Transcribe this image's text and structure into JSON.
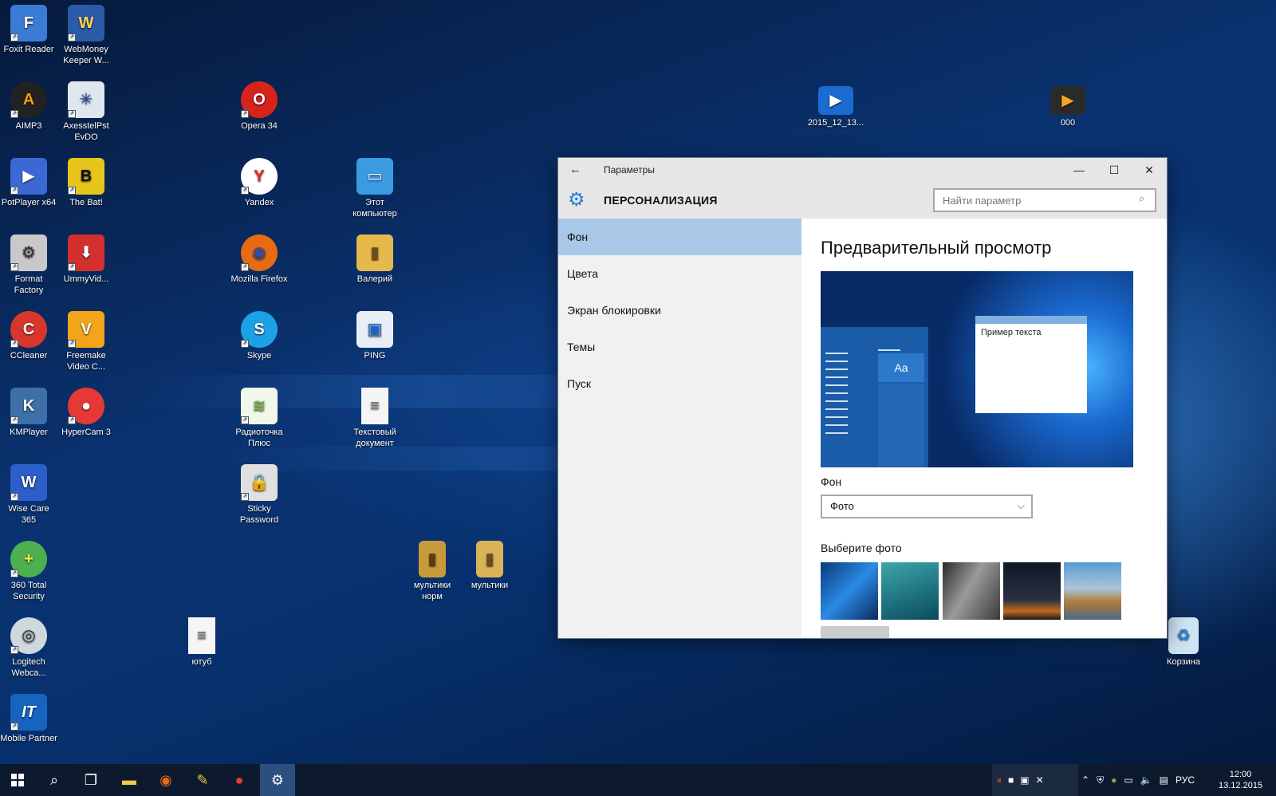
{
  "desktop": {
    "icons": [
      {
        "label": "Foxit Reader",
        "bg": "#3a7bd5",
        "glyph": "F"
      },
      {
        "label": "WebMoney Keeper W...",
        "bg": "#2b5aa8",
        "glyph": "W"
      },
      {
        "label": "AIMP3",
        "bg": "#f39c12",
        "glyph": "A"
      },
      {
        "label": "AxesstelPst EvDO",
        "bg": "#dfe6ee",
        "glyph": "✳"
      },
      {
        "label": "Opera 34",
        "bg": "#d6241c",
        "glyph": "O"
      },
      {
        "label": "2015_12_13...",
        "bg": "#1b6bd1",
        "glyph": "▶"
      },
      {
        "label": "000",
        "bg": "#2a2a2a",
        "glyph": "▶"
      },
      {
        "label": "PotPlayer x64",
        "bg": "#3c68d6",
        "glyph": "▶"
      },
      {
        "label": "The Bat!",
        "bg": "#e8c51d",
        "glyph": "B"
      },
      {
        "label": "Yandex",
        "bg": "#ffffff",
        "glyph": "Y"
      },
      {
        "label": "Этот компьютер",
        "bg": "#3a9be3",
        "glyph": "▭"
      },
      {
        "label": "Format Factory",
        "bg": "#c9c9c9",
        "glyph": "⚙"
      },
      {
        "label": "UmmyVid...",
        "bg": "#d32f2f",
        "glyph": "⬇"
      },
      {
        "label": "Mozilla Firefox",
        "bg": "#e66b12",
        "glyph": "◉"
      },
      {
        "label": "Валерий",
        "bg": "#e6b94d",
        "glyph": "▮"
      },
      {
        "label": "CCleaner",
        "bg": "#d9362b",
        "glyph": "C"
      },
      {
        "label": "Freemake Video C...",
        "bg": "#f2a51a",
        "glyph": "V"
      },
      {
        "label": "Skype",
        "bg": "#1da1e6",
        "glyph": "S"
      },
      {
        "label": "PING",
        "bg": "#1e64c8",
        "glyph": "▣"
      },
      {
        "label": "KMPlayer",
        "bg": "#3f6fa8",
        "glyph": "K"
      },
      {
        "label": "HyperCam 3",
        "bg": "#e53935",
        "glyph": "●"
      },
      {
        "label": "Радиоточка Плюс",
        "bg": "#7cb342",
        "glyph": "≋"
      },
      {
        "label": "Текстовый документ",
        "bg": "#f5f5f5",
        "glyph": "≡"
      },
      {
        "label": "Wise Care 365",
        "bg": "#2c5fc9",
        "glyph": "W"
      },
      {
        "label": "Sticky Password",
        "bg": "#e0e0e0",
        "glyph": "🔒"
      },
      {
        "label": "360 Total Security",
        "bg": "#4caf50",
        "glyph": "+"
      },
      {
        "label": "мультики норм",
        "bg": "#c99a3c",
        "glyph": "▮"
      },
      {
        "label": "мультики",
        "bg": "#d8b35a",
        "glyph": "▮"
      },
      {
        "label": "Logitech Webca...",
        "bg": "#cfd8dc",
        "glyph": "◎"
      },
      {
        "label": "ютуб",
        "bg": "#f5f5f5",
        "glyph": "≡"
      },
      {
        "label": "Корзина",
        "bg": "#cfe3f3",
        "glyph": "♻"
      },
      {
        "label": "Mobile Partner",
        "bg": "#1565c0",
        "glyph": "IT"
      }
    ]
  },
  "window": {
    "title": "Параметры",
    "section": "ПЕРСОНАЛИЗАЦИЯ",
    "search_placeholder": "Найти параметр",
    "nav": [
      {
        "label": "Фон",
        "active": true
      },
      {
        "label": "Цвета",
        "active": false
      },
      {
        "label": "Экран блокировки",
        "active": false
      },
      {
        "label": "Темы",
        "active": false
      },
      {
        "label": "Пуск",
        "active": false
      }
    ],
    "content": {
      "title": "Предварительный просмотр",
      "preview_sample_text": "Пример текста",
      "preview_tile_text": "Aa",
      "background_label": "Фон",
      "background_value": "Фото",
      "choose_photo_label": "Выберите фото"
    }
  },
  "taskbar": {
    "language": "РУС",
    "time": "12:00",
    "date": "13.12.2015"
  },
  "colors": {
    "accent": "#2b79d8",
    "nav_active": "#a9c8e8",
    "taskbar": "#0d1a2e"
  }
}
